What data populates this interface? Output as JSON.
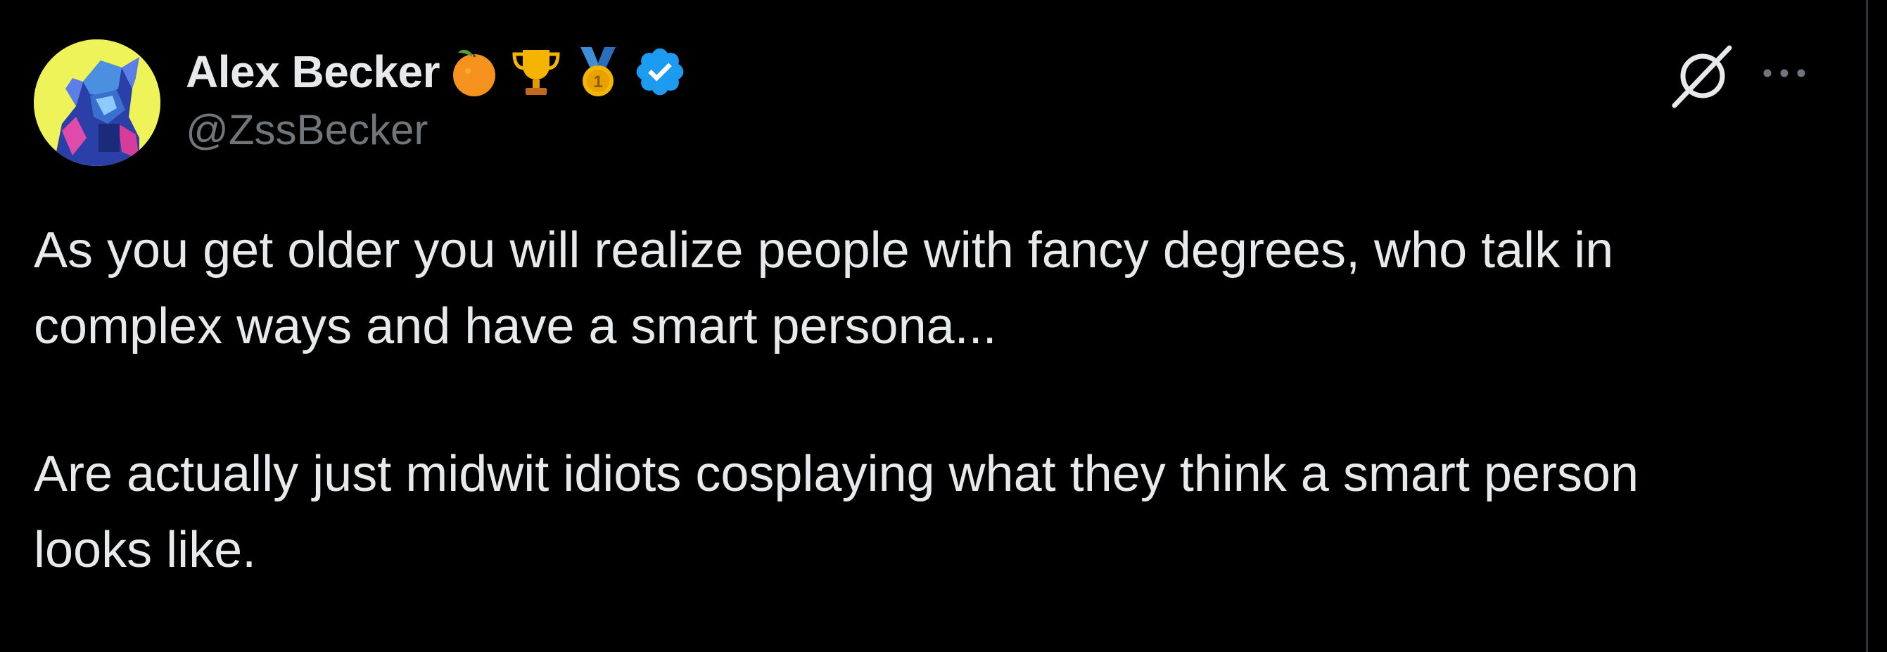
{
  "author": {
    "display_name": "Alex Becker",
    "handle": "@ZssBecker",
    "badges": [
      "tangerine-icon",
      "trophy-icon",
      "first-place-medal-icon",
      "verified-badge-icon"
    ],
    "verified_color": "#1d9bf0"
  },
  "actions": {
    "grok_icon": "grok-icon",
    "more_icon": "more-options-icon"
  },
  "tweet": {
    "line1": "As you get older you will realize people with fancy degrees, who talk in",
    "line2": "complex ways and have a smart persona...",
    "line3": "Are actually just midwit idiots cosplaying what they think a smart person",
    "line4": "looks like."
  },
  "colors": {
    "background": "#000000",
    "text_primary": "#e7e9ea",
    "text_secondary": "#71767b"
  }
}
